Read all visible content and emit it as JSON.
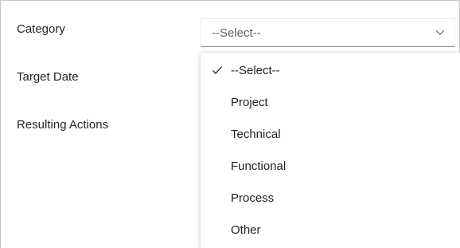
{
  "form": {
    "fields": [
      {
        "label": "Category"
      },
      {
        "label": "Target Date"
      },
      {
        "label": "Resulting Actions"
      }
    ],
    "category_select": {
      "value": "--Select--",
      "icon": "chevron-down-icon"
    }
  },
  "dropdown": {
    "selected_index": 0,
    "check_icon": "checkmark-icon",
    "options": [
      {
        "label": "--Select--"
      },
      {
        "label": "Project"
      },
      {
        "label": "Technical"
      },
      {
        "label": "Functional"
      },
      {
        "label": "Process"
      },
      {
        "label": "Other"
      }
    ]
  },
  "colors": {
    "border": "#c8c8c8",
    "input_underline": "#7a8ea8",
    "text": "#242424",
    "placeholder": "#616161"
  }
}
